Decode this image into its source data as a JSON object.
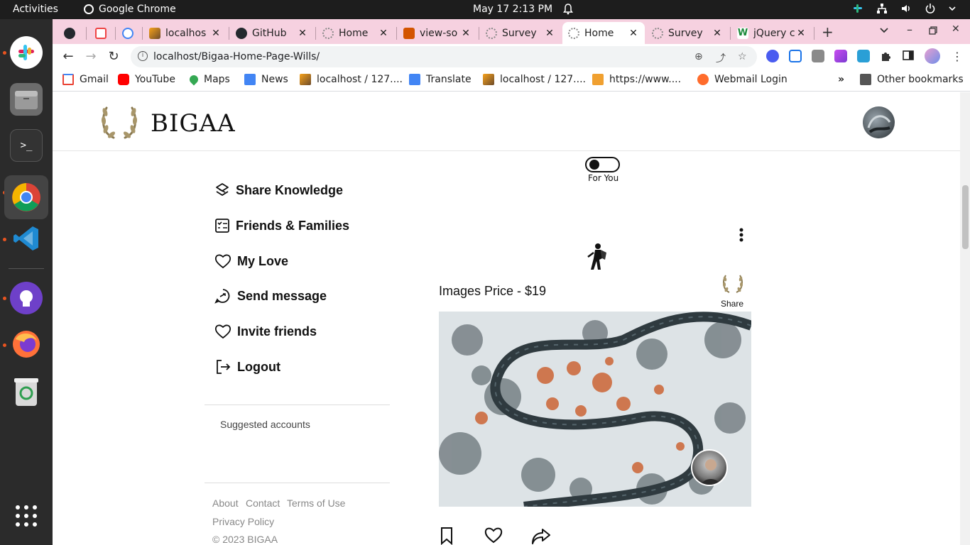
{
  "os": {
    "activities": "Activities",
    "app_name": "Google Chrome",
    "clock": "May 17  2:13 PM"
  },
  "browser": {
    "tabs": [
      {
        "label": ""
      },
      {
        "label": ""
      },
      {
        "label": ""
      },
      {
        "label": "localhos"
      },
      {
        "label": "GitHub"
      },
      {
        "label": "Home"
      },
      {
        "label": "view-so"
      },
      {
        "label": "Survey"
      },
      {
        "label": "Home",
        "active": true
      },
      {
        "label": "Survey"
      },
      {
        "label": "jQuery c"
      }
    ],
    "url": "localhost/Bigaa-Home-Page-Wills/",
    "bookmarks": [
      {
        "label": "Gmail"
      },
      {
        "label": "YouTube"
      },
      {
        "label": "Maps"
      },
      {
        "label": "News"
      },
      {
        "label": "localhost / 127...."
      },
      {
        "label": "Translate"
      },
      {
        "label": "localhost / 127...."
      },
      {
        "label": "https://www...."
      },
      {
        "label": "Webmail Login"
      }
    ],
    "overflow": "»",
    "other_bookmarks": "Other bookmarks"
  },
  "site": {
    "brand": "BIGAA",
    "toggle_label": "For You",
    "menu": [
      {
        "label": "Share Knowledge",
        "icon": "share-knowledge-icon"
      },
      {
        "label": "Friends & Families",
        "icon": "checklist-icon"
      },
      {
        "label": "My Love",
        "icon": "heart-icon"
      },
      {
        "label": "Send message",
        "icon": "send-message-icon"
      },
      {
        "label": "Invite friends",
        "icon": "heart-icon"
      },
      {
        "label": "Logout",
        "icon": "logout-icon"
      }
    ],
    "suggested_accounts": "Suggested accounts",
    "footer": {
      "about": "About",
      "contact": "Contact",
      "terms": "Terms of Use",
      "privacy": "Privacy Policy",
      "copyright": "© 2023 BIGAA"
    },
    "post": {
      "title": "Images Price - $19",
      "share_label": "Share"
    }
  },
  "colors": {
    "tab_strip": "#f6d1e0",
    "dock": "#2b2b2b",
    "topbar": "#1d1d1d"
  }
}
